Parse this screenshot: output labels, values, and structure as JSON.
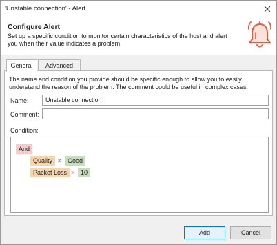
{
  "window": {
    "title": "'Unstable connection' - Alert",
    "close_symbol": "×"
  },
  "header": {
    "title": "Configure Alert",
    "description": "Set up a specific condition to monitor certain characteristics of the host and alert you when their value indicates a problem.",
    "icon": "bell-icon",
    "icon_color": "#e05a3f"
  },
  "tabs": [
    {
      "label": "General",
      "active": true
    },
    {
      "label": "Advanced",
      "active": false
    }
  ],
  "general": {
    "intro": "The name and condition you provide should be specific enough to allow you to easily understand the reason of the problem. The comment could be useful in complex cases.",
    "name_label": "Name:",
    "name_value": "Unstable connection",
    "comment_label": "Comment:",
    "comment_value": "",
    "condition_label": "Condition:"
  },
  "condition": {
    "group": "And",
    "rules": [
      {
        "attribute": "Quality",
        "operator": "≠",
        "value": "Good"
      },
      {
        "attribute": "Packet Loss",
        "operator": ">",
        "value": "10"
      }
    ]
  },
  "buttons": {
    "add": "Add",
    "cancel": "Cancel"
  },
  "colors": {
    "and_chip": "#f3c9c9",
    "attribute_chip": "#f6d5ad",
    "value_chip": "#c9dcc0",
    "primary_border": "#0078d7"
  }
}
